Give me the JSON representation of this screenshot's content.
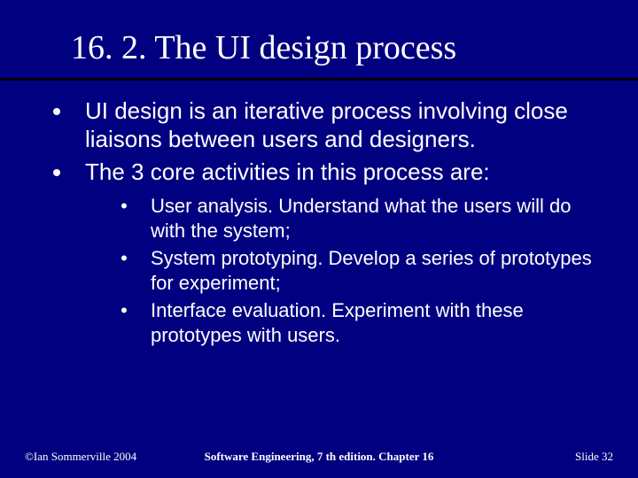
{
  "title": "16. 2. The UI design process",
  "bullets": [
    "UI design is an iterative process involving close liaisons between users and designers.",
    "The 3 core activities in this process are:"
  ],
  "sub": [
    {
      "lead": "User analysis",
      "rest": ". Understand what the users will do with the system;"
    },
    {
      "lead": "System prototyping",
      "rest": ". Develop a series of prototypes for experiment;"
    },
    {
      "lead": "Interface evaluation",
      "rest": ". Experiment with these prototypes with users."
    }
  ],
  "footer": {
    "left": "©Ian Sommerville 2004",
    "center": "Software Engineering, 7 th edition. Chapter 16",
    "right_label": "Slide",
    "right_num": "32"
  }
}
